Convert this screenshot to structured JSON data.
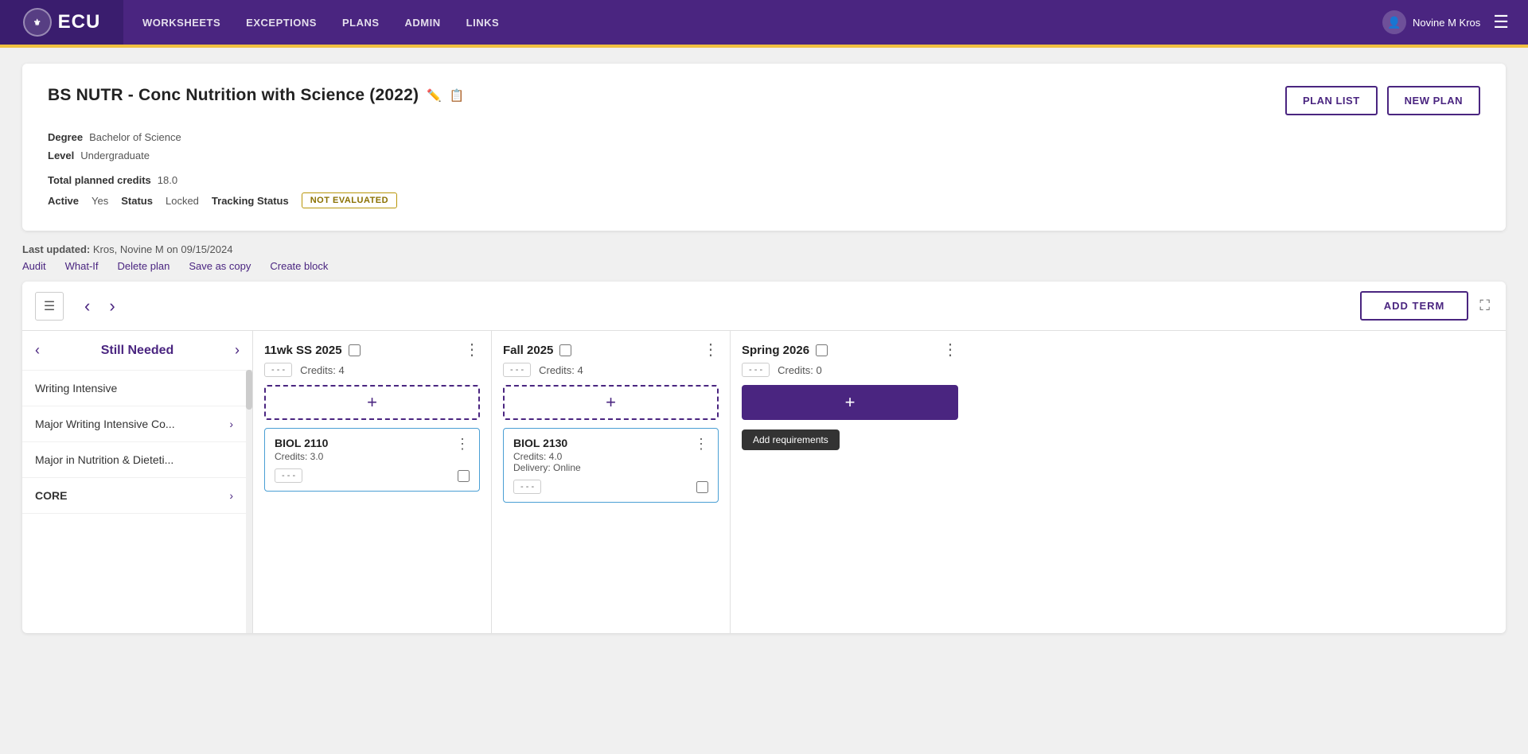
{
  "topnav": {
    "logo": "ECU",
    "links": [
      "WORKSHEETS",
      "EXCEPTIONS",
      "PLANS",
      "ADMIN",
      "LINKS"
    ],
    "user": "Novine M Kros"
  },
  "plan": {
    "title": "BS NUTR  -  Conc Nutrition with Science  (2022)",
    "actions": {
      "plan_list": "PLAN LIST",
      "new_plan": "NEW PLAN"
    },
    "degree_label": "Degree",
    "degree_value": "Bachelor of Science",
    "level_label": "Level",
    "level_value": "Undergraduate",
    "total_credits_label": "Total planned credits",
    "total_credits_value": "18.0",
    "active_label": "Active",
    "active_value": "Yes",
    "status_label": "Status",
    "status_value": "Locked",
    "tracking_label": "Tracking Status",
    "tracking_badge": "NOT EVALUATED"
  },
  "action_links": {
    "last_updated": "Last updated:",
    "updated_by": "Kros, Novine M on 09/15/2024",
    "audit": "Audit",
    "what_if": "What-If",
    "delete_plan": "Delete plan",
    "save_copy": "Save as copy",
    "create_block": "Create block"
  },
  "workspace": {
    "add_term_label": "ADD TERM",
    "sidebar": {
      "title": "Still Needed",
      "items": [
        {
          "label": "Writing Intensive",
          "has_arrow": false
        },
        {
          "label": "Major Writing Intensive Co...",
          "has_arrow": true
        },
        {
          "label": "Major in Nutrition & Dieteti...",
          "has_arrow": false
        },
        {
          "label": "CORE",
          "has_arrow": true
        }
      ]
    },
    "terms": [
      {
        "title": "11wk SS 2025",
        "gpa": "- - -",
        "credits": "Credits: 4",
        "courses": [
          {
            "name": "BIOL 2110",
            "credits": "Credits: 3.0",
            "delivery": "",
            "gpa": "- - -"
          }
        ]
      },
      {
        "title": "Fall 2025",
        "gpa": "- - -",
        "credits": "Credits: 4",
        "courses": [
          {
            "name": "BIOL 2130",
            "credits": "Credits: 4.0",
            "delivery": "Delivery: Online",
            "gpa": "- - -"
          }
        ]
      },
      {
        "title": "Spring 2026",
        "gpa": "- - -",
        "credits": "Credits: 0",
        "courses": [],
        "add_requirements": "Add requirements"
      }
    ]
  }
}
